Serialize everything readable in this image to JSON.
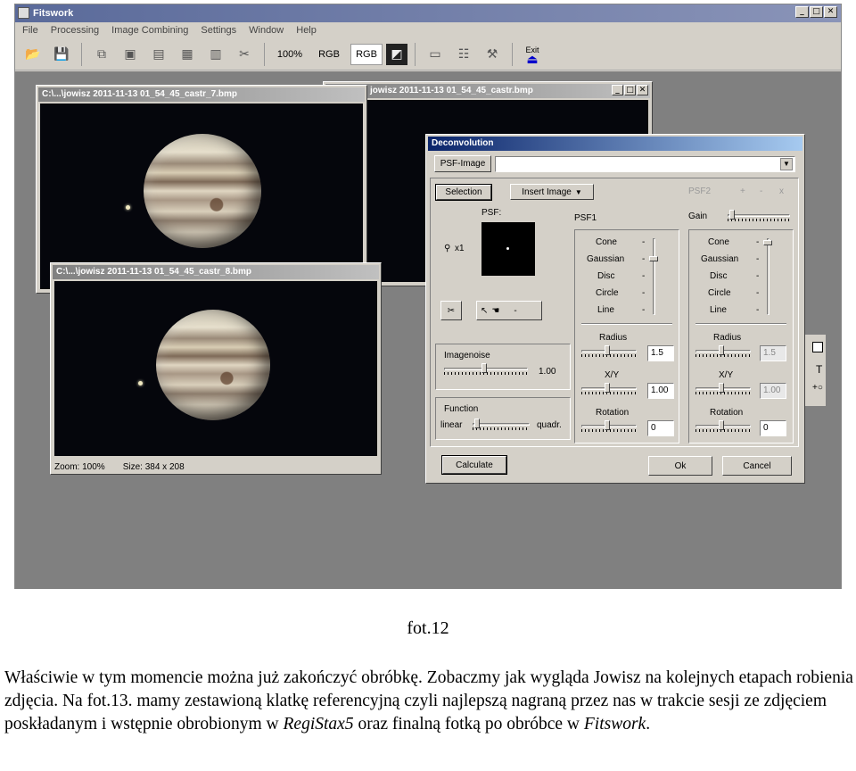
{
  "app": {
    "title": "Fitswork",
    "menu": [
      "File",
      "Processing",
      "Image Combining",
      "Settings",
      "Window",
      "Help"
    ],
    "toolbar": {
      "zoom_label": "100%",
      "rgb1": "RGB",
      "rgb2": "RGB",
      "exit": "Exit"
    }
  },
  "windows": {
    "back": {
      "title": "jowisz 2011-11-13 01_54_45_castr.bmp"
    },
    "left": {
      "title": "C:\\...\\jowisz 2011-11-13 01_54_45_castr_7.bmp"
    },
    "front": {
      "title": "C:\\...\\jowisz 2011-11-13 01_54_45_castr_8.bmp",
      "zoom": "Zoom: 100%",
      "size": "Size: 384 x 208"
    }
  },
  "deconv": {
    "title": "Deconvolution",
    "psf_image_btn": "PSF-Image",
    "selection_btn": "Selection",
    "insert_image_btn": "Insert Image",
    "psf_label": "PSF:",
    "zoom": "x1",
    "psf1": "PSF1",
    "psf2": "PSF2",
    "gain": "Gain",
    "psf2_ops": [
      "+",
      "-",
      "x"
    ],
    "dash": "-",
    "shapes": [
      "Cone",
      "Gaussian",
      "Disc",
      "Circle",
      "Line"
    ],
    "radius_label": "Radius",
    "xy_label": "X/Y",
    "rotation_label": "Rotation",
    "psf1_radius": "1.5",
    "psf1_xy": "1.00",
    "psf1_rotation": "0",
    "psf2_radius": "1.5",
    "psf2_xy": "1.00",
    "psf2_rotation": "0",
    "imagenoise_label": "Imagenoise",
    "imagenoise_value": "1.00",
    "function_label": "Function",
    "function_left": "linear",
    "function_right": "quadr.",
    "calculate": "Calculate",
    "ok": "Ok",
    "cancel": "Cancel"
  },
  "palette": {
    "t": "T"
  },
  "document": {
    "caption": "fot.12",
    "p1": "Właściwie w tym momencie można już zakończyć obróbkę. Zobaczmy jak wygląda Jowisz na kolejnych etapach robienia zdjęcia. Na fot.13. mamy zestawioną klatkę referencyjną czyli najlepszą nagraną przez nas w trakcie sesji ze zdjęciem poskładanym i wstępnie obrobionym w ",
    "registax": "RegiStax5",
    "p2": " oraz finalną fotką po obróbce w ",
    "fitswork": "Fitswork",
    "p3": "."
  }
}
